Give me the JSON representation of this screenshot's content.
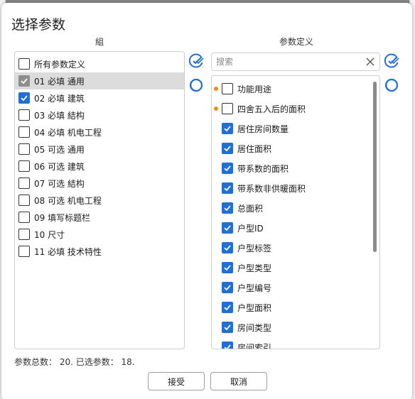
{
  "dialog": {
    "title": "选择参数"
  },
  "groups": {
    "header": "組",
    "items": [
      {
        "label": "所有参数定义",
        "checked": false,
        "selected": false
      },
      {
        "label": "01 必填 通用",
        "checked": true,
        "selected": true,
        "tint": "gray"
      },
      {
        "label": "02 必填 建筑",
        "checked": true,
        "selected": false
      },
      {
        "label": "03 必填 結构",
        "checked": false,
        "selected": false
      },
      {
        "label": "04 必填 机电工程",
        "checked": false,
        "selected": false
      },
      {
        "label": "05 可选 通用",
        "checked": false,
        "selected": false
      },
      {
        "label": "06 可选 建筑",
        "checked": false,
        "selected": false
      },
      {
        "label": "07 可选 結构",
        "checked": false,
        "selected": false
      },
      {
        "label": "08 可选 机电工程",
        "checked": false,
        "selected": false
      },
      {
        "label": "09 填写标题栏",
        "checked": false,
        "selected": false
      },
      {
        "label": "10 尺寸",
        "checked": false,
        "selected": false
      },
      {
        "label": "11 必填 技术特性",
        "checked": false,
        "selected": false
      }
    ]
  },
  "definitions": {
    "header": "参数定义",
    "search_placeholder": "搜索",
    "items": [
      {
        "label": "功能用途",
        "checked": false,
        "marker": true
      },
      {
        "label": "四舍五入后的面积",
        "checked": false,
        "marker": true
      },
      {
        "label": "居住房间数量",
        "checked": true,
        "marker": false
      },
      {
        "label": "居住面积",
        "checked": true,
        "marker": false
      },
      {
        "label": "带系数的面积",
        "checked": true,
        "marker": false
      },
      {
        "label": "带系数非供暖面积",
        "checked": true,
        "marker": false
      },
      {
        "label": "总面积",
        "checked": true,
        "marker": false
      },
      {
        "label": "户型ID",
        "checked": true,
        "marker": false
      },
      {
        "label": "户型标签",
        "checked": true,
        "marker": false
      },
      {
        "label": "户型类型",
        "checked": true,
        "marker": false
      },
      {
        "label": "户型编号",
        "checked": true,
        "marker": false
      },
      {
        "label": "户型面积",
        "checked": true,
        "marker": false
      },
      {
        "label": "房间类型",
        "checked": true,
        "marker": false
      },
      {
        "label": "房间索引",
        "checked": true,
        "marker": false
      }
    ]
  },
  "status": {
    "text": "参数总数： 20. 已选参数： 18."
  },
  "buttons": {
    "accept": "接受",
    "cancel": "取消"
  },
  "colors": {
    "accent": "#1f6fd6",
    "marker": "#f08c16",
    "selected_row": "#dcdcdc"
  },
  "icons": {
    "select_all": "check-all-icon",
    "deselect_all": "circle-clear-icon",
    "clear_search": "close-icon"
  }
}
